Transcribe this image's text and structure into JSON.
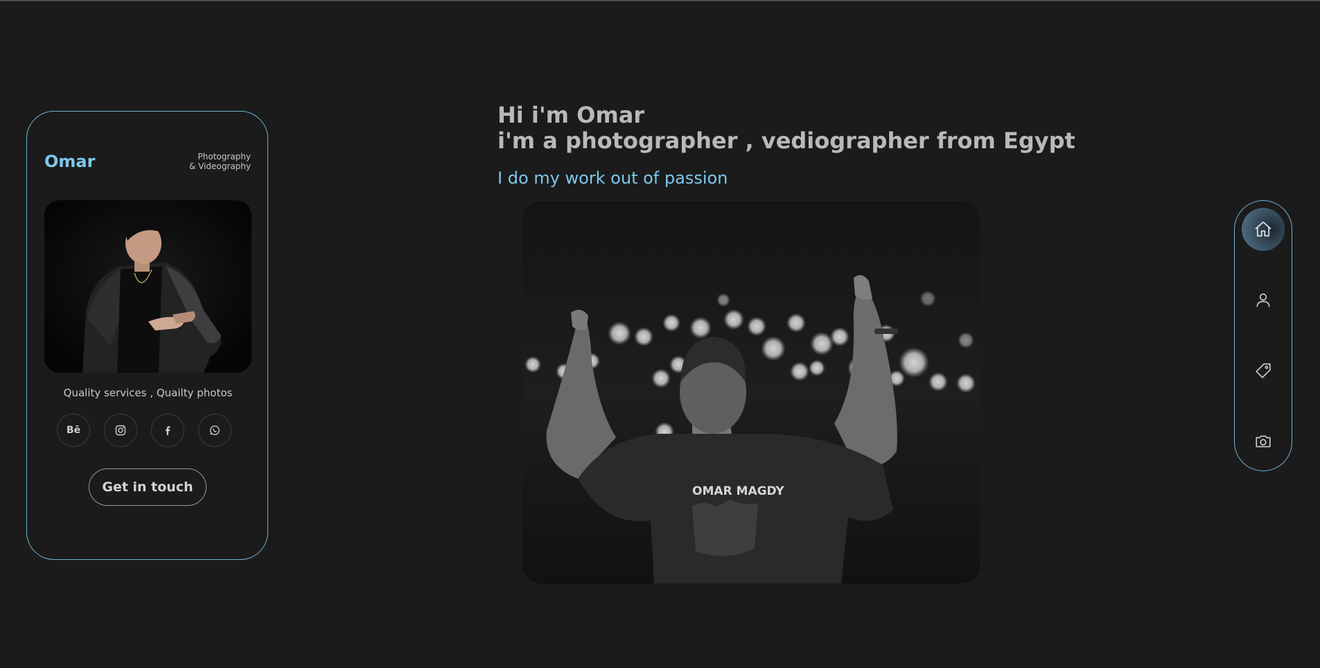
{
  "profile": {
    "name": "Omar",
    "tagline_line1": "Photography",
    "tagline_line2": "& Videography",
    "quote": "Quality services , Quailty photos",
    "socials": [
      {
        "icon": "behance-icon",
        "label": "Bē"
      },
      {
        "icon": "instagram-icon"
      },
      {
        "icon": "facebook-icon"
      },
      {
        "icon": "whatsapp-icon"
      }
    ],
    "cta_label": "Get in touch"
  },
  "hero": {
    "title_line1": "Hi i'm Omar",
    "title_line2": "i'm a photographer , vediographer from Egypt",
    "subtitle": "I do my work out of passion",
    "shirt_text": "OMAR MAGDY"
  },
  "nav": {
    "items": [
      {
        "icon": "home-icon",
        "active": true
      },
      {
        "icon": "user-icon",
        "active": false
      },
      {
        "icon": "tag-icon",
        "active": false
      },
      {
        "icon": "camera-icon",
        "active": false
      }
    ]
  },
  "colors": {
    "background": "#1b1b1b",
    "accent": "#7ec8ec",
    "border": "#6fb3d6",
    "text": "#b9b9b9"
  }
}
